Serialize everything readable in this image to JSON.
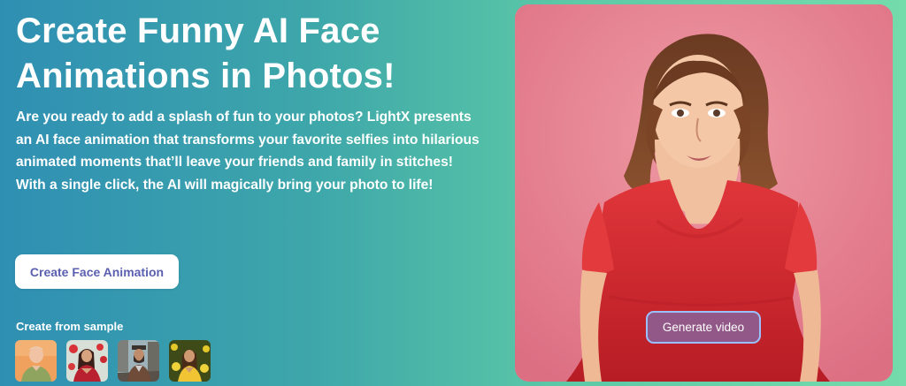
{
  "hero": {
    "title": "Create Funny AI Face Animations in Photos!",
    "description": "Are you ready to add a splash of fun to your photos? LightX presents an AI face animation that transforms your favorite selfies into hilarious animated moments that’ll leave your friends and family in stitches! With a single click, the AI will magically bring your photo to life!",
    "cta_label": "Create Face Animation"
  },
  "samples": {
    "label": "Create from sample",
    "items": [
      {
        "name": "older-man-sample",
        "icon": "sample-thumbnail"
      },
      {
        "name": "woman-red-flowers-sample",
        "icon": "sample-thumbnail"
      },
      {
        "name": "man-city-sample",
        "icon": "sample-thumbnail"
      },
      {
        "name": "woman-yellow-flowers-sample",
        "icon": "sample-thumbnail"
      }
    ]
  },
  "preview": {
    "generate_label": "Generate video",
    "accent_colors": {
      "background": "#e98694",
      "dress": "#d92b2f",
      "button_border": "#9ac0ff"
    }
  },
  "theme": {
    "gradient_start": "#2f8fb3",
    "gradient_end": "#74dbab",
    "cta_text_color": "#5b5fb0"
  }
}
